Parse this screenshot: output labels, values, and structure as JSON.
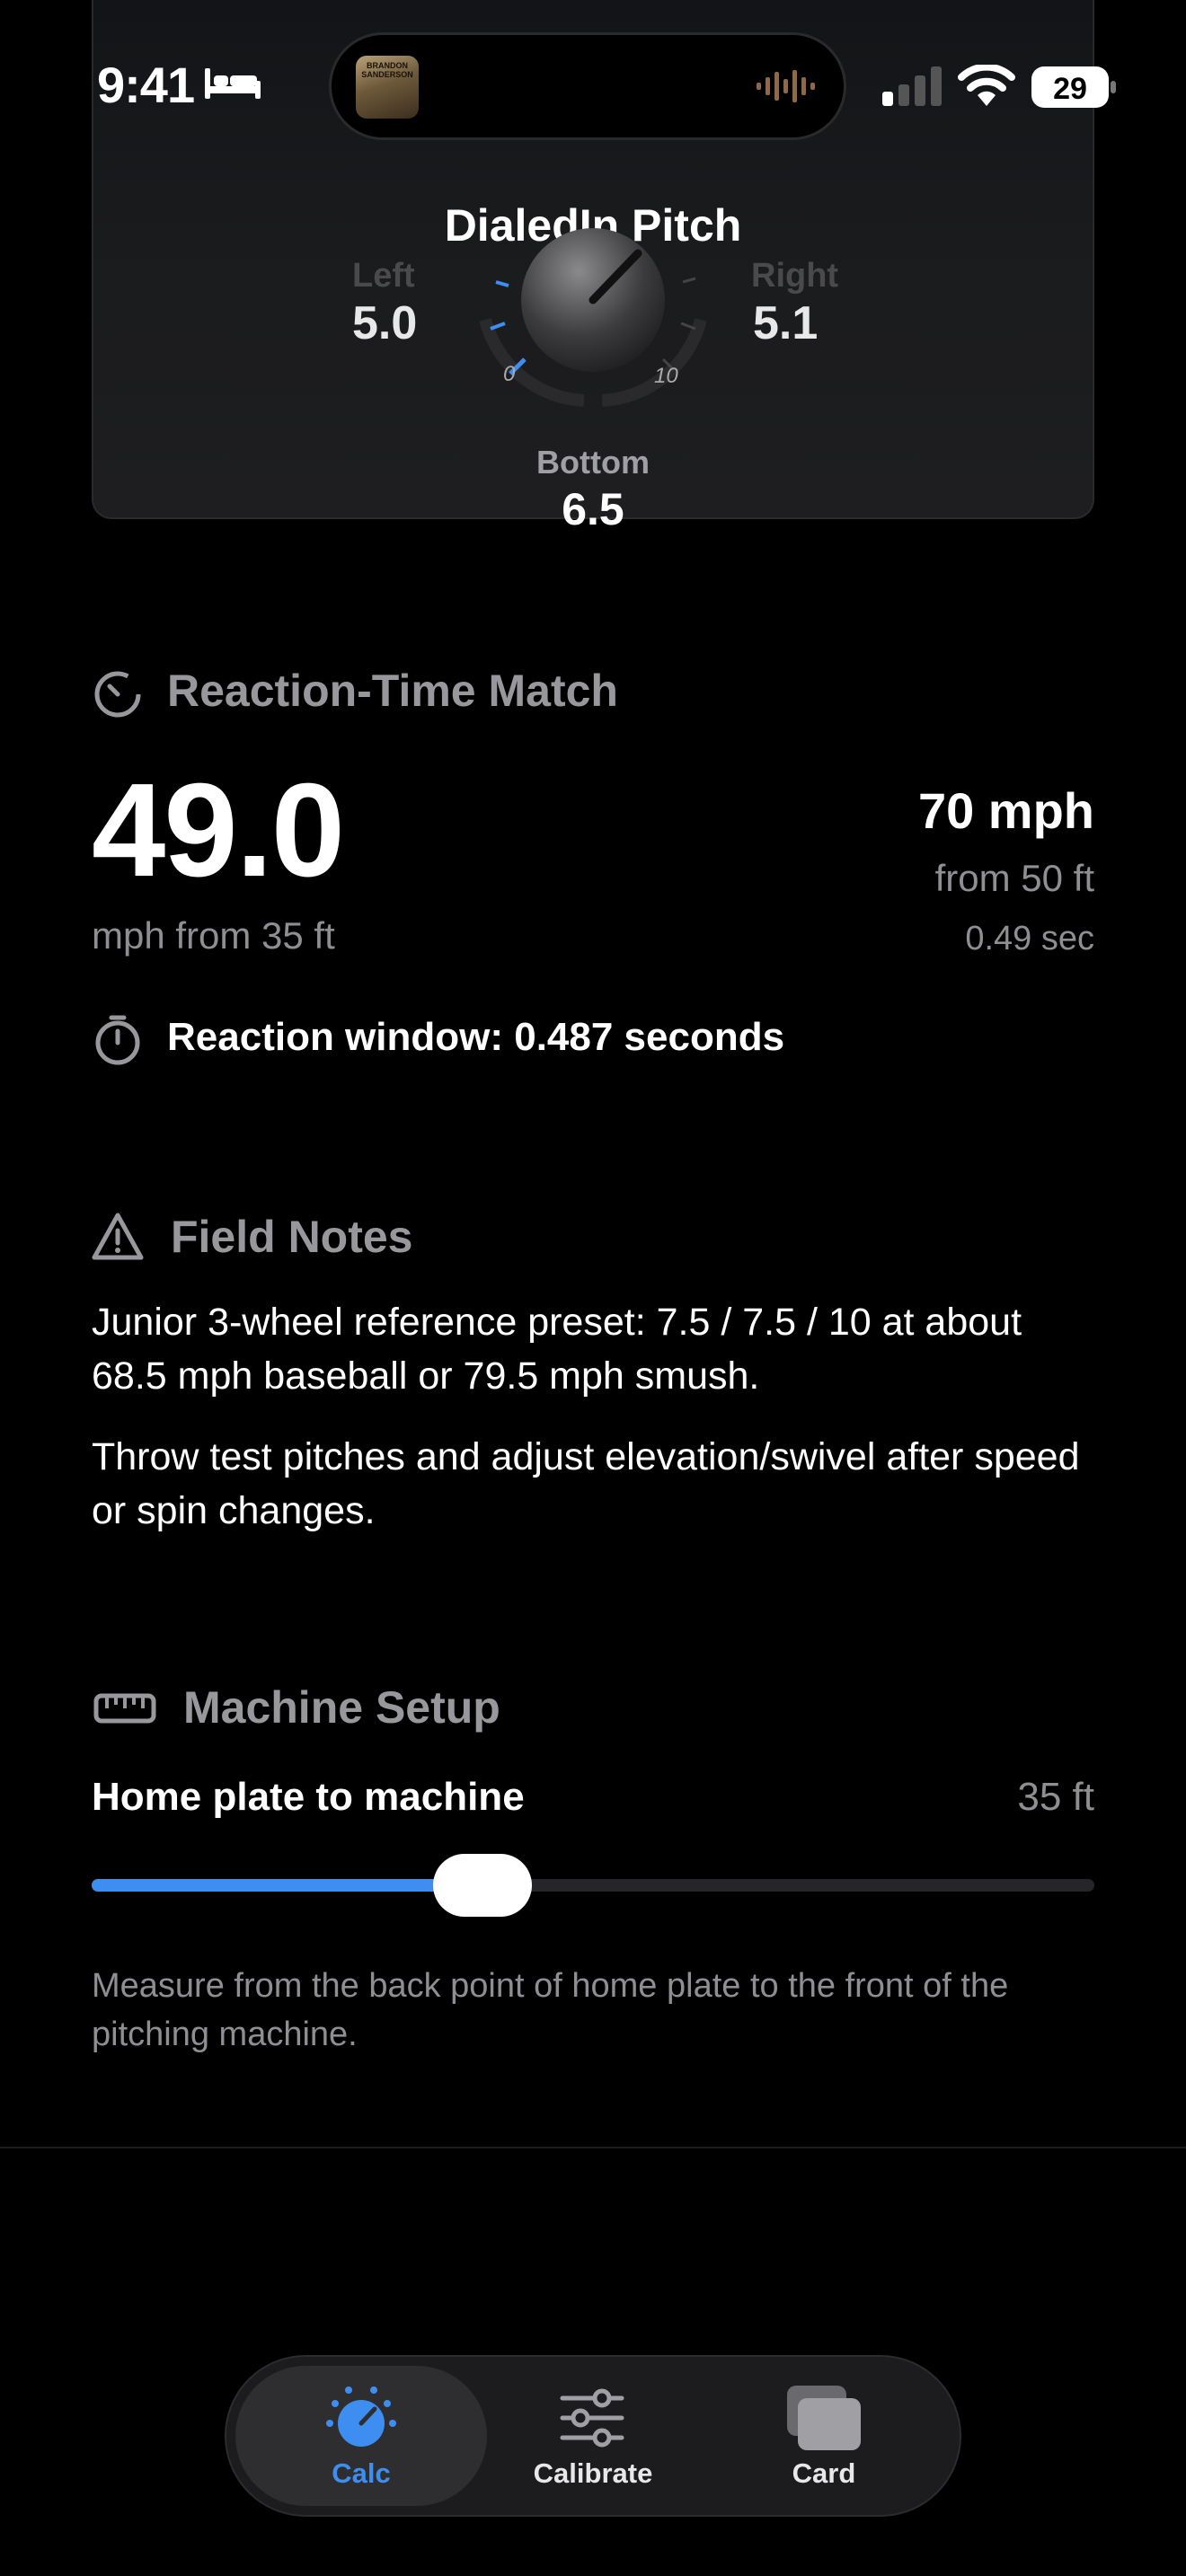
{
  "status": {
    "time": "9:41",
    "battery": "29"
  },
  "pitch_card": {
    "title": "DialedIn Pitch",
    "left_label": "Left",
    "left_value": "5.0",
    "right_label": "Right",
    "right_value": "5.1",
    "bottom_label": "Bottom",
    "bottom_value": "6.5",
    "knob_min": "0",
    "knob_max": "10"
  },
  "reaction": {
    "title": "Reaction-Time Match",
    "speed": "49.0",
    "speed_sub": "mph from 35 ft",
    "compare_speed": "70 mph",
    "compare_distance": "from 50 ft",
    "compare_time": "0.49 sec",
    "window_text": "Reaction window: 0.487 seconds"
  },
  "field_notes": {
    "title": "Field Notes",
    "paragraphs": [
      "Junior 3-wheel reference preset: 7.5 / 7.5 / 10 at about 68.5 mph baseball or 79.5 mph smush.",
      "Throw test pitches and adjust elevation/swivel after speed or spin changes."
    ]
  },
  "machine_setup": {
    "title": "Machine Setup",
    "distance_label": "Home plate to machine",
    "distance_value": "35 ft",
    "slider_fraction": 0.39,
    "hint": "Measure from the back point of home plate to the front of the pitching machine."
  },
  "tabs": [
    {
      "label": "Calc",
      "icon": "dial-icon",
      "active": true
    },
    {
      "label": "Calibrate",
      "icon": "sliders-icon",
      "active": false
    },
    {
      "label": "Card",
      "icon": "cards-icon",
      "active": false
    }
  ],
  "colors": {
    "accent": "#3d8ef0",
    "background": "#000000",
    "muted": "#8e8e93"
  }
}
